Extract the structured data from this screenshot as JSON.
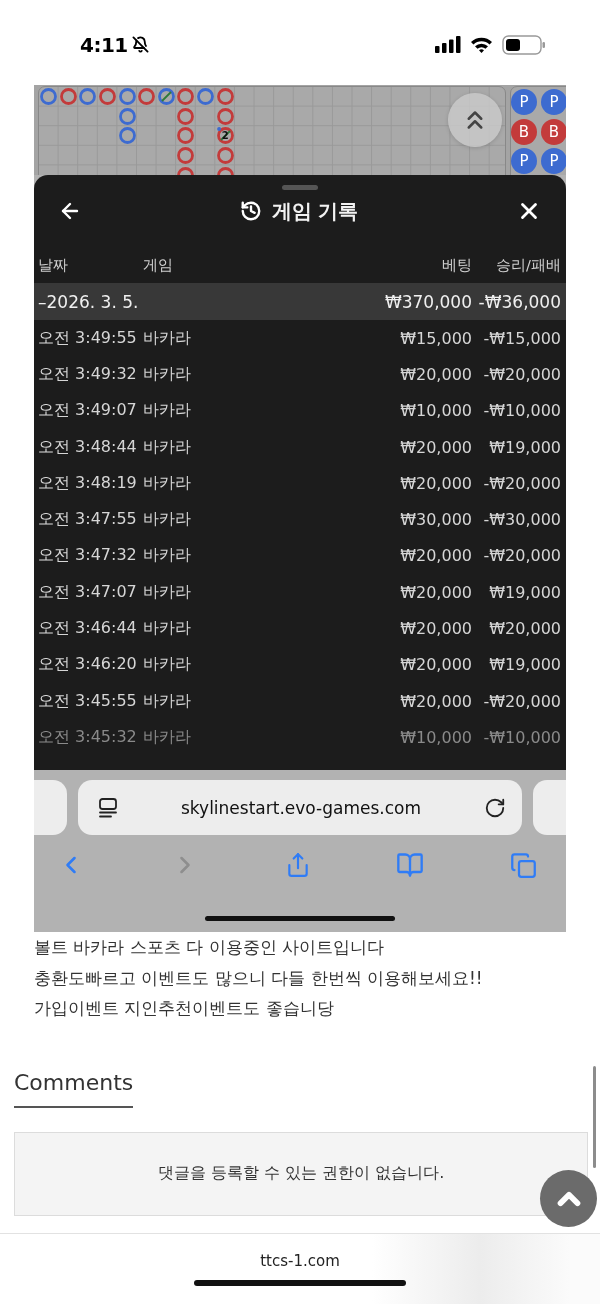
{
  "status_bar": {
    "time": "4:11",
    "silent": true
  },
  "game_screen": {
    "road": {
      "columns": [
        [
          {
            "color": "#3d6bd0",
            "tie": false,
            "player_pair": false
          }
        ],
        [
          {
            "color": "#c33b3b",
            "tie": false,
            "player_pair": false
          }
        ],
        [
          {
            "color": "#3d6bd0",
            "tie": false,
            "player_pair": false
          }
        ],
        [
          {
            "color": "#c33b3b",
            "tie": false,
            "player_pair": false
          }
        ],
        [
          {
            "color": "#3d6bd0",
            "tie": false,
            "player_pair": false
          },
          {
            "color": "#3d6bd0",
            "tie": false,
            "player_pair": false
          },
          {
            "color": "#3d6bd0",
            "tie": false,
            "player_pair": false
          }
        ],
        [
          {
            "color": "#c33b3b",
            "tie": false,
            "player_pair": false
          }
        ],
        [
          {
            "color": "#3d6bd0",
            "tie": true,
            "player_pair": false
          }
        ],
        [
          {
            "color": "#c33b3b",
            "tie": false,
            "player_pair": false
          },
          {
            "color": "#c33b3b",
            "tie": false,
            "player_pair": false
          },
          {
            "color": "#c33b3b",
            "tie": false,
            "player_pair": false
          },
          {
            "color": "#c33b3b",
            "tie": false,
            "player_pair": false
          },
          {
            "color": "#c33b3b",
            "tie": false,
            "player_pair": false
          }
        ],
        [
          {
            "color": "#3d6bd0",
            "tie": false,
            "player_pair": false
          }
        ],
        [
          {
            "color": "#c33b3b",
            "tie": false,
            "player_pair": false
          },
          {
            "color": "#c33b3b",
            "tie": false,
            "player_pair": false
          },
          {
            "color": "#c33b3b",
            "tie": true,
            "player_pair": true,
            "tie_count": "2"
          },
          {
            "color": "#c33b3b",
            "tie": false,
            "player_pair": false
          },
          {
            "color": "#c33b3b",
            "tie": false,
            "player_pair": false
          }
        ]
      ]
    },
    "side_road": {
      "columns": [
        [
          {
            "label": "P",
            "color": "#3d6bd0"
          },
          {
            "label": "B",
            "color": "#c33b3b"
          },
          {
            "label": "P",
            "color": "#3d6bd0"
          }
        ],
        [
          {
            "label": "P",
            "color": "#3d6bd0"
          },
          {
            "label": "B",
            "color": "#c33b3b"
          },
          {
            "label": "P",
            "color": "#3d6bd0"
          }
        ]
      ]
    },
    "history_sheet": {
      "title": "게임 기록",
      "columns": [
        "날짜",
        "게임",
        "베팅",
        "승리/패배"
      ],
      "date_group": {
        "date": "–2026. 3. 5.",
        "bet": "₩370,000",
        "result": "-₩36,000"
      },
      "rows": [
        {
          "time": "오전 3:49:55",
          "game": "바카라",
          "bet": "₩15,000",
          "result": "-₩15,000"
        },
        {
          "time": "오전 3:49:32",
          "game": "바카라",
          "bet": "₩20,000",
          "result": "-₩20,000"
        },
        {
          "time": "오전 3:49:07",
          "game": "바카라",
          "bet": "₩10,000",
          "result": "-₩10,000"
        },
        {
          "time": "오전 3:48:44",
          "game": "바카라",
          "bet": "₩20,000",
          "result": "₩19,000"
        },
        {
          "time": "오전 3:48:19",
          "game": "바카라",
          "bet": "₩20,000",
          "result": "-₩20,000"
        },
        {
          "time": "오전 3:47:55",
          "game": "바카라",
          "bet": "₩30,000",
          "result": "-₩30,000"
        },
        {
          "time": "오전 3:47:32",
          "game": "바카라",
          "bet": "₩20,000",
          "result": "-₩20,000"
        },
        {
          "time": "오전 3:47:07",
          "game": "바카라",
          "bet": "₩20,000",
          "result": "₩19,000"
        },
        {
          "time": "오전 3:46:44",
          "game": "바카라",
          "bet": "₩20,000",
          "result": "₩20,000"
        },
        {
          "time": "오전 3:46:20",
          "game": "바카라",
          "bet": "₩20,000",
          "result": "₩19,000"
        },
        {
          "time": "오전 3:45:55",
          "game": "바카라",
          "bet": "₩20,000",
          "result": "-₩20,000"
        }
      ],
      "faded_row": {
        "time": "오전 3:45:32",
        "game": "바카라",
        "bet": "₩10,000",
        "result": "-₩10,000"
      }
    },
    "browser": {
      "url": "skylinestart.evo-games.com",
      "back_enabled": true,
      "forward_enabled": false
    }
  },
  "post": {
    "lines": [
      "볼트 바카라 스포츠 다 이용중인 사이트입니다",
      "충환도빠르고 이벤트도 많으니 다들 한번씩 이용해보세요!!",
      "가입이벤트 지인추천이벤트도 좋습니당"
    ]
  },
  "comments": {
    "title": "Comments",
    "notice": "댓글을 등록할 수 있는 권한이 없습니다."
  },
  "browser_bar": {
    "domain": "ttcs-1.com"
  }
}
